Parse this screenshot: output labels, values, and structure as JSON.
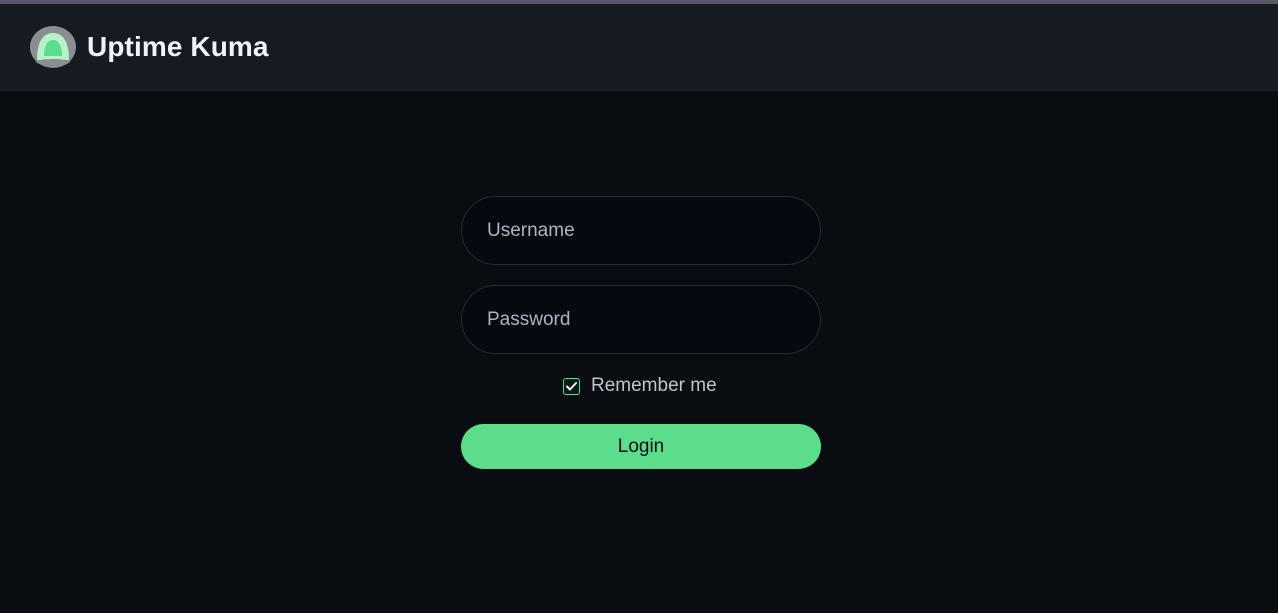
{
  "app": {
    "name": "Uptime Kuma",
    "logo_icon": "uptime-kuma-logo-icon"
  },
  "login_form": {
    "username": {
      "value": "",
      "placeholder": "Username"
    },
    "password": {
      "value": "",
      "placeholder": "Password"
    },
    "remember_me": {
      "label": "Remember me",
      "checked": true,
      "icon": "checkmark-icon"
    },
    "submit_label": "Login"
  },
  "colors": {
    "accent": "#5cdd8b",
    "page_background": "#090c10",
    "header_background": "#161b22",
    "input_background": "#060910",
    "text_primary": "#f0f3f6"
  }
}
